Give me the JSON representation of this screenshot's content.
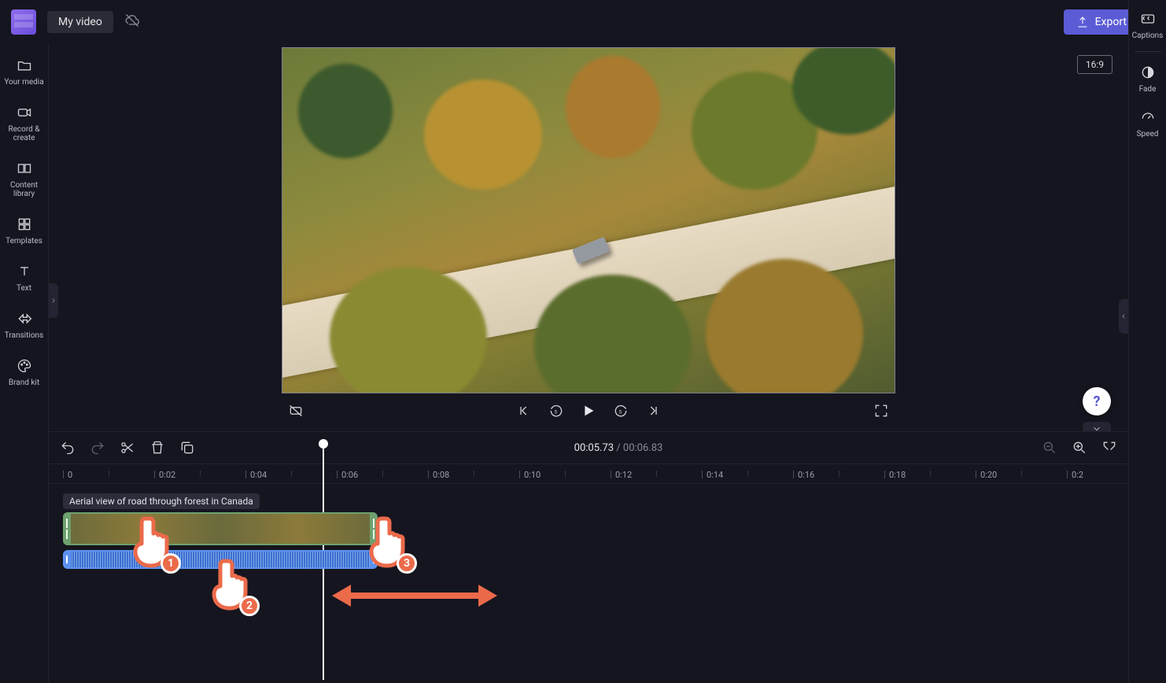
{
  "header": {
    "project_title": "My video",
    "export_label": "Export"
  },
  "left_sidebar": {
    "items": [
      {
        "key": "your-media",
        "label": "Your media"
      },
      {
        "key": "record-create",
        "label": "Record & create"
      },
      {
        "key": "content-library",
        "label": "Content library"
      },
      {
        "key": "templates",
        "label": "Templates"
      },
      {
        "key": "text",
        "label": "Text"
      },
      {
        "key": "transitions",
        "label": "Transitions"
      },
      {
        "key": "brand-kit",
        "label": "Brand kit"
      }
    ]
  },
  "right_sidebar": {
    "items": [
      {
        "key": "captions",
        "label": "Captions"
      },
      {
        "key": "fade",
        "label": "Fade"
      },
      {
        "key": "speed",
        "label": "Speed"
      }
    ]
  },
  "preview": {
    "aspect_label": "16:9"
  },
  "timeline": {
    "current_time": "00:05.73",
    "duration": "00:06.83",
    "ticks": [
      "0",
      "0:02",
      "0:04",
      "0:06",
      "0:08",
      "0:10",
      "0:12",
      "0:14",
      "0:16",
      "0:18",
      "0:20",
      "0:2"
    ],
    "clip_label": "Aerial view of road through forest in Canada",
    "annotations": {
      "hand1": "1",
      "hand2": "2",
      "hand3": "3"
    }
  }
}
